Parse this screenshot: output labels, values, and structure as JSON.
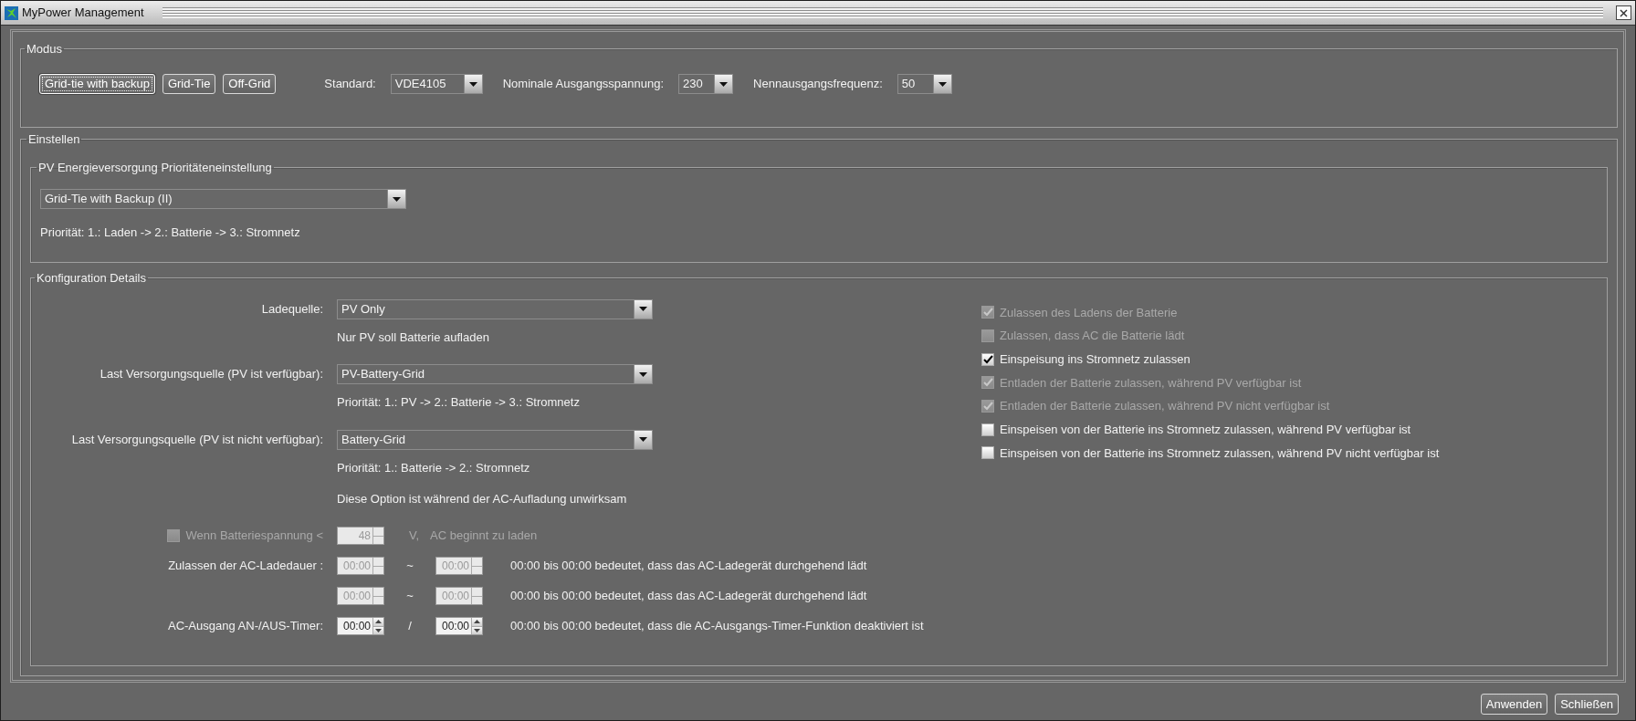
{
  "window": {
    "title": "MyPower Management"
  },
  "modus": {
    "legend": "Modus",
    "mode_buttons": [
      {
        "label": "Grid-tie with backup",
        "selected": true
      },
      {
        "label": "Grid-Tie",
        "selected": false
      },
      {
        "label": "Off-Grid",
        "selected": false
      }
    ],
    "selects": [
      {
        "label": "Standard:",
        "value": "VDE4105"
      },
      {
        "label": "Nominale Ausgangsspannung:",
        "value": "230"
      },
      {
        "label": "Nennausgangsfrequenz:",
        "value": "50"
      }
    ]
  },
  "einstellen": {
    "legend": "Einstellen",
    "pv_priority": {
      "legend": "PV Energieversorgung Prioritäteneinstellung",
      "value": "Grid-Tie with Backup (II)",
      "note": "Priorität: 1.: Laden -> 2.: Batterie -> 3.: Stromnetz"
    },
    "konfiguration": {
      "legend": "Konfiguration Details",
      "sources": [
        {
          "label": "Ladequelle:",
          "value": "PV Only",
          "notes": [
            "Nur PV soll Batterie aufladen"
          ]
        },
        {
          "label": "Last Versorgungsquelle (PV ist verfügbar):",
          "value": "PV-Battery-Grid",
          "notes": [
            "Priorität: 1.: PV -> 2.: Batterie -> 3.: Stromnetz"
          ]
        },
        {
          "label": "Last Versorgungsquelle (PV ist nicht verfügbar):",
          "value": "Battery-Grid",
          "notes": [
            "Priorität: 1.: Batterie -> 2.: Stromnetz",
            "Diese Option ist während der AC-Aufladung unwirksam"
          ]
        }
      ],
      "checkboxes": [
        {
          "label": "Zulassen des Ladens der Batterie",
          "checked": true,
          "disabled": true
        },
        {
          "label": "Zulassen, dass AC die Batterie lädt",
          "checked": false,
          "disabled": true
        },
        {
          "label": "Einspeisung ins Stromnetz zulassen",
          "checked": true,
          "disabled": false
        },
        {
          "label": "Entladen der Batterie zulassen, während PV verfügbar ist",
          "checked": true,
          "disabled": true
        },
        {
          "label": "Entladen der Batterie zulassen, während PV nicht verfügbar ist",
          "checked": true,
          "disabled": true
        },
        {
          "label": "Einspeisen von der Batterie ins Stromnetz zulassen, während PV verfügbar ist",
          "checked": false,
          "disabled": false
        },
        {
          "label": "Einspeisen von der Batterie ins Stromnetz zulassen, während PV nicht verfügbar ist",
          "checked": false,
          "disabled": false
        }
      ],
      "battery_voltage": {
        "label": "Wenn Batteriespannung <",
        "checked": false,
        "disabled": true,
        "value": "48",
        "unit": "V,",
        "suffix": "AC beginnt zu laden"
      },
      "timer_rows": [
        {
          "label": "Zulassen der AC-Ladedauer :",
          "from": "00:00",
          "separator": "~",
          "to": "00:00",
          "disabled": true,
          "note": "00:00 bis 00:00 bedeutet, dass das AC-Ladegerät durchgehend lädt"
        },
        {
          "from": "00:00",
          "separator": "~",
          "to": "00:00",
          "disabled": true,
          "note": "00:00 bis 00:00 bedeutet, dass das AC-Ladegerät durchgehend lädt"
        },
        {
          "label": "AC-Ausgang AN-/AUS-Timer:",
          "from": "00:00",
          "separator": "/",
          "to": "00:00",
          "disabled": false,
          "note": "00:00 bis 00:00 bedeutet, dass die AC-Ausgangs-Timer-Funktion deaktiviert ist"
        }
      ]
    }
  },
  "footer_buttons": [
    "Anwenden",
    "Schließen"
  ]
}
